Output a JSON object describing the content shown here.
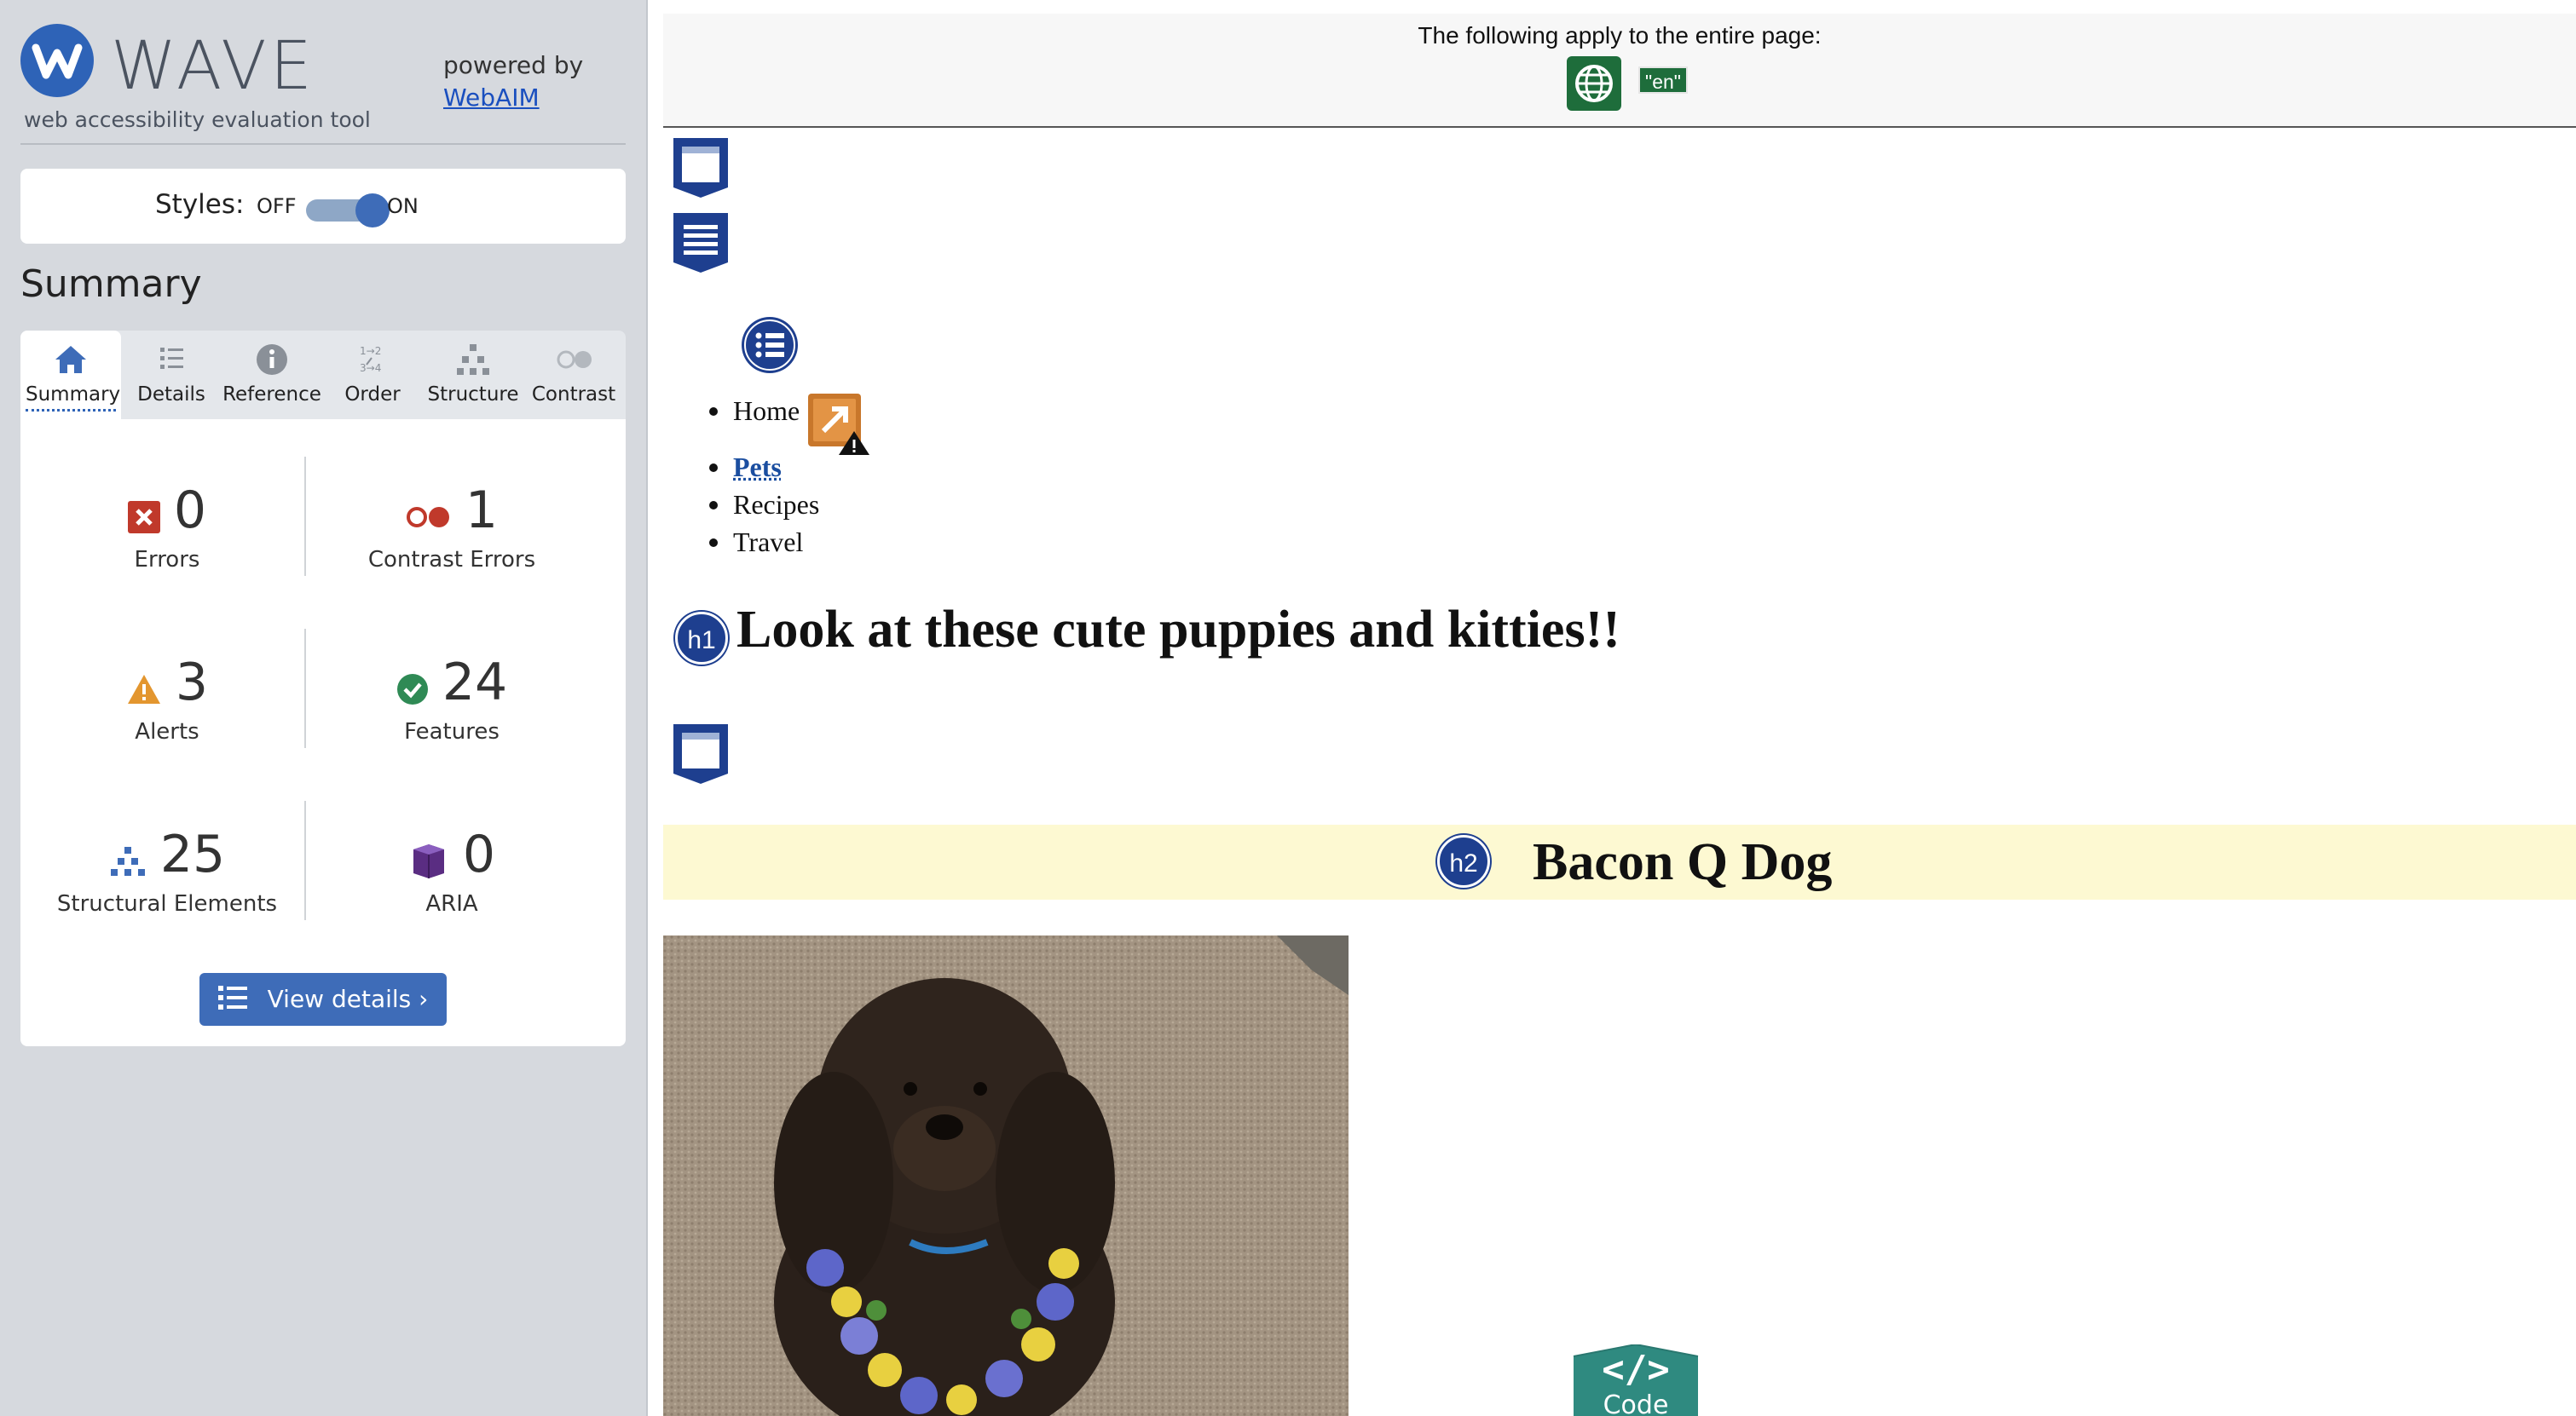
{
  "sidebar": {
    "logo_word": "WAVE",
    "logo_subtitle": "web accessibility evaluation tool",
    "powered_by": "powered by",
    "powered_link": "WebAIM",
    "styles": {
      "label": "Styles:",
      "off": "OFF",
      "on": "ON",
      "state": "on"
    },
    "summary_title": "Summary",
    "tabs": [
      {
        "label": "Summary",
        "icon": "home-icon",
        "active": true
      },
      {
        "label": "Details",
        "icon": "list-icon",
        "active": false
      },
      {
        "label": "Reference",
        "icon": "info-icon",
        "active": false
      },
      {
        "label": "Order",
        "icon": "order-icon",
        "active": false
      },
      {
        "label": "Structure",
        "icon": "hierarchy-icon",
        "active": false
      },
      {
        "label": "Contrast",
        "icon": "contrast-icon",
        "active": false
      }
    ],
    "stats": [
      {
        "value": "0",
        "label": "Errors",
        "icon": "error-icon",
        "color": "#c0392b"
      },
      {
        "value": "1",
        "label": "Contrast Errors",
        "icon": "contrast-error-icon",
        "color": "#c0392b"
      },
      {
        "value": "3",
        "label": "Alerts",
        "icon": "alert-icon",
        "color": "#e3962f"
      },
      {
        "value": "24",
        "label": "Features",
        "icon": "feature-check-icon",
        "color": "#2f8a55"
      },
      {
        "value": "25",
        "label": "Structural Elements",
        "icon": "structure-icon",
        "color": "#3e6cb8"
      },
      {
        "value": "0",
        "label": "ARIA",
        "icon": "aria-cube-icon",
        "color": "#5a2d82"
      }
    ],
    "view_details": "View details ›"
  },
  "main": {
    "page_banner": "The following apply to the entire page:",
    "lang_badge": "\"en\"",
    "nav_items": [
      {
        "label": "Home",
        "is_link": false
      },
      {
        "label": "Pets",
        "is_link": true
      },
      {
        "label": "Recipes",
        "is_link": false
      },
      {
        "label": "Travel",
        "is_link": false
      }
    ],
    "h1_badge": "h1",
    "h1_text": "Look at these cute puppies and kitties!!",
    "h2_badge": "h2",
    "h2_text": "Bacon Q Dog",
    "code_button": "Code"
  },
  "colors": {
    "wave_blue": "#2e63b7",
    "sidebar_bg": "#d6d9de",
    "heading_badge": "#1e3f8f",
    "h2_band": "#fdf9d2",
    "lang_green": "#1e6d3b",
    "code_teal": "#2f8a80"
  }
}
